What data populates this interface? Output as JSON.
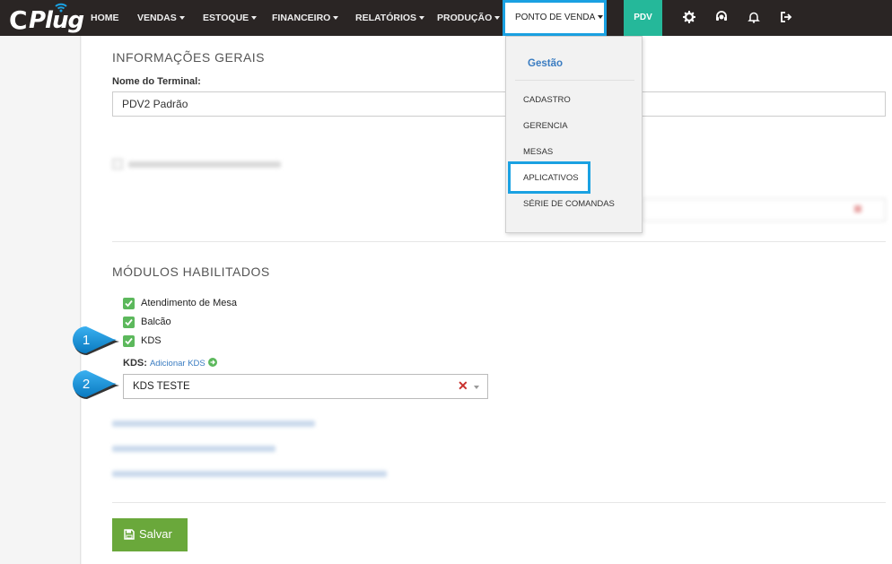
{
  "nav": {
    "logo_c": "C",
    "logo_text": "Plug",
    "items": [
      {
        "label": "HOME",
        "has_caret": false
      },
      {
        "label": "VENDAS",
        "has_caret": true
      },
      {
        "label": "ESTOQUE",
        "has_caret": true
      },
      {
        "label": "FINANCEIRO",
        "has_caret": true
      },
      {
        "label": "RELATÓRIOS",
        "has_caret": true
      },
      {
        "label": "PRODUÇÃO",
        "has_caret": true
      }
    ],
    "active_item": "PONTO DE VENDA",
    "pdv_label": "PDV",
    "icons": [
      "gear-icon",
      "support-icon",
      "bell-icon",
      "logout-icon"
    ]
  },
  "dropdown": {
    "header": "Gestão",
    "items": [
      "CADASTRO",
      "GERENCIA",
      "MESAS",
      "APLICATIVOS",
      "SÉRIE DE COMANDAS"
    ],
    "highlighted": "APLICATIVOS"
  },
  "general": {
    "section_title": "INFORMAÇÕES GERAIS",
    "terminal_label": "Nome do Terminal:",
    "terminal_value": "PDV2 Padrão"
  },
  "modules": {
    "section_title": "MÓDULOS HABILITADOS",
    "items": [
      {
        "label": "Atendimento de Mesa",
        "checked": true
      },
      {
        "label": "Balcão",
        "checked": true
      },
      {
        "label": "KDS",
        "checked": true
      }
    ],
    "kds_label": "KDS:",
    "kds_add_link": "Adicionar KDS",
    "kds_selected": "KDS TESTE"
  },
  "callouts": [
    "1",
    "2"
  ],
  "save_label": "Salvar",
  "colors": {
    "navbar": "#2a2524",
    "highlight": "#1aa1e2",
    "pdv": "#25b89a",
    "checkbox": "#5cb85c",
    "save": "#6aa83b",
    "link": "#3a7cc1"
  }
}
